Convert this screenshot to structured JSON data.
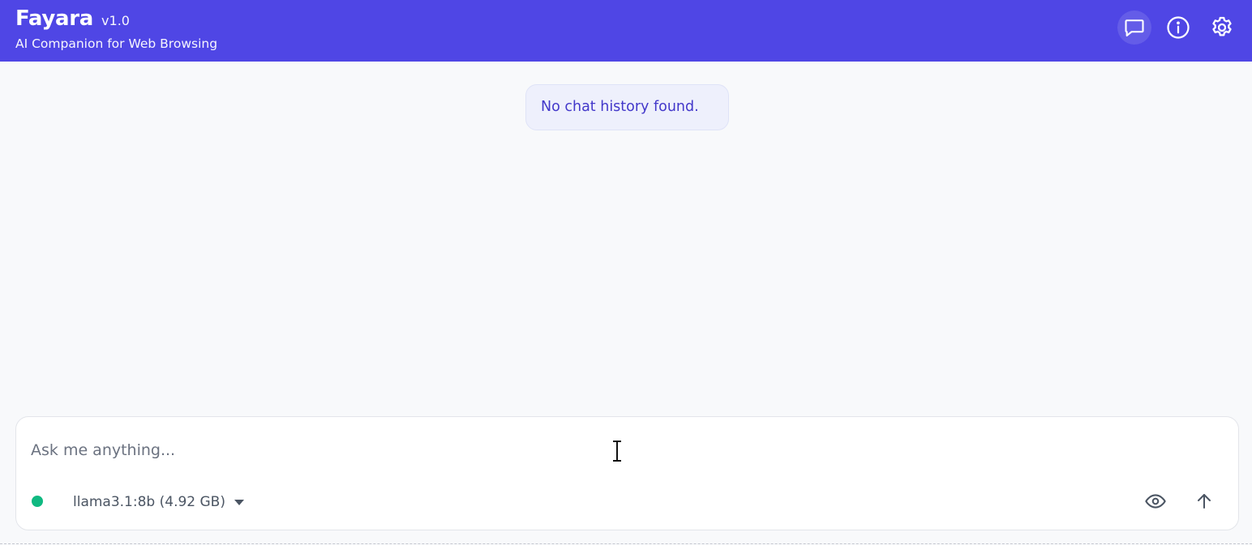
{
  "header": {
    "app_name": "Fayara",
    "version": "v1.0",
    "tagline": "AI Companion for Web Browsing",
    "background_color": "#4f46e5",
    "actions": [
      {
        "name": "chat",
        "icon": "chat-bubble-icon",
        "active": true
      },
      {
        "name": "info",
        "icon": "info-icon",
        "active": false
      },
      {
        "name": "settings",
        "icon": "gear-icon",
        "active": false
      }
    ]
  },
  "history": {
    "empty_message": "No chat history found."
  },
  "composer": {
    "placeholder": "Ask me anything...",
    "value": "",
    "model": {
      "status_color": "#10b981",
      "selected": "llama3.1:8b (4.92 GB)"
    },
    "buttons": {
      "toggle_page_context_icon": "eye-icon",
      "send_icon": "arrow-up-icon"
    }
  }
}
